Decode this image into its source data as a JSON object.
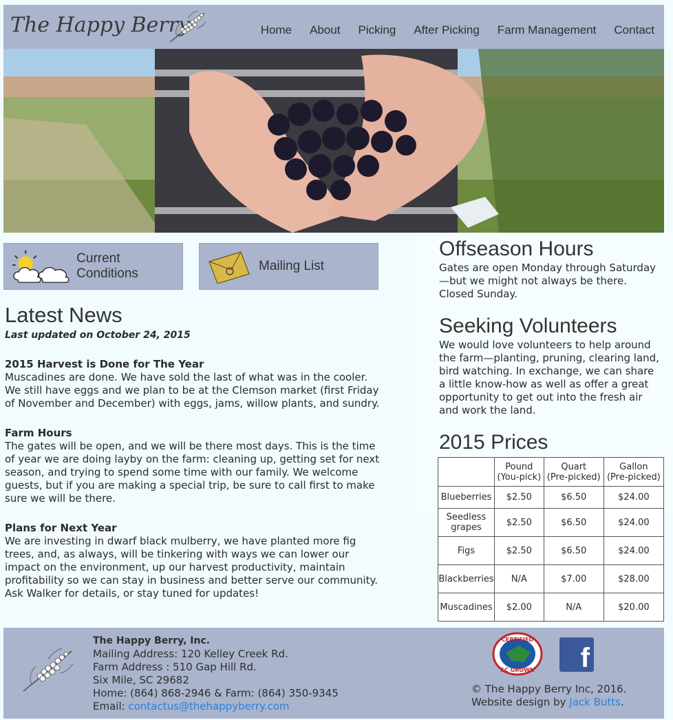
{
  "site": {
    "title": "The Happy Berry"
  },
  "nav": [
    "Home",
    "About",
    "Picking",
    "After Picking",
    "Farm Management",
    "Contact"
  ],
  "buttons": {
    "conditions": "Current Conditions",
    "mailing": "Mailing List"
  },
  "news": {
    "title": "Latest News",
    "updated": "Last updated on October 24, 2015",
    "articles": [
      {
        "heading": "2015 Harvest is Done for The Year",
        "body": "Muscadines are done. We have sold the last of what was in the cooler. We still have eggs and we plan to be at the Clemson market (first Friday of November and December) with eggs, jams, willow plants, and sundry."
      },
      {
        "heading": "Farm Hours",
        "body": "The gates will be open, and we will be there most days. This is the time of year we are doing layby on the farm: cleaning up, getting set for next season, and trying to spend some time with our family. We welcome guests, but if you are making a special trip, be sure to call first to make sure we will be there."
      },
      {
        "heading": "Plans for Next Year",
        "body": "We are investing in dwarf black mulberry, we have planted more fig trees, and, as always, will be tinkering with ways we can lower our impact on the environment, up our harvest productivity, maintain profitability so we can stay in business and better serve our community. Ask Walker for details, or stay tuned for updates!"
      }
    ]
  },
  "offseason": {
    "title": "Offseason Hours",
    "body": "Gates are open Monday through Saturday—but we might not always be there. Closed Sunday."
  },
  "volunteers": {
    "title": "Seeking Volunteers",
    "body": "We would love volunteers to help around the farm—planting, pruning, clearing land, bird watching. In exchange, we can share a little know-how as well as offer a great opportunity to get out into the fresh air and work the land."
  },
  "prices": {
    "title": "2015 Prices",
    "headers": [
      "",
      "Pound\n(You-pick)",
      "Quart\n(Pre-picked)",
      "Gallon\n(Pre-picked)"
    ],
    "rows": [
      [
        "Blueberries",
        "$2.50",
        "$6.50",
        "$24.00"
      ],
      [
        "Seedless grapes",
        "$2.50",
        "$6.50",
        "$24.00"
      ],
      [
        "Figs",
        "$2.50",
        "$6.50",
        "$24.00"
      ],
      [
        "Blackberries",
        "N/A",
        "$7.00",
        "$28.00"
      ],
      [
        "Muscadines",
        "$2.00",
        "N/A",
        "$20.00"
      ]
    ]
  },
  "footer": {
    "company": "The Happy Berry, Inc.",
    "mailing": "Mailing Address: 120 Kelley Creek Rd.",
    "farm": "Farm Address : 510 Gap Hill Rd.",
    "city": "Six Mile, SC 29682",
    "phones": "Home: (864) 868-2946 & Farm: (864) 350-9345",
    "email_label": "Email: ",
    "email": "contactus@thehappyberry.com",
    "copyright": "© The Happy Berry Inc, 2016.",
    "design_label": "Website design by ",
    "designer": "Jack Butts",
    "design_end": ".",
    "badge_top": "CERTIFIED",
    "badge_bottom": "SC GROWN"
  },
  "icons": {
    "logo": "berry-branch-icon",
    "weather": "sun-cloud-icon",
    "mail": "envelope-icon",
    "facebook": "facebook-icon"
  }
}
